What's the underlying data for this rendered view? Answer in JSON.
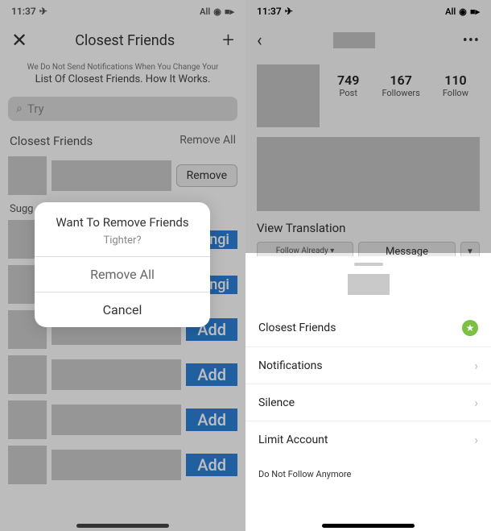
{
  "left": {
    "status": {
      "time": "11:37",
      "signal": "All"
    },
    "header": {
      "title": "Closest Friends"
    },
    "info": {
      "line1": "We Do Not Send Notifications When You Change Your",
      "line2": "List Of Closest Friends. How It Works."
    },
    "search": {
      "placeholder": "Try"
    },
    "section": {
      "label": "Closest Friends",
      "remove_all": "Remove All"
    },
    "remove_btn": "Remove",
    "suggested": "Sugg",
    "add_btn": "Add",
    "modal": {
      "title": "Want To Remove Friends",
      "subtitle": "Tighter?",
      "remove_all": "Remove All",
      "cancel": "Cancel"
    }
  },
  "right": {
    "status": {
      "time": "11:37",
      "signal": "All"
    },
    "stats": {
      "posts_num": "749",
      "posts_label": "Post",
      "followers_num": "167",
      "followers_label": "Followers",
      "following_num": "110",
      "following_label": "Follow"
    },
    "view_translation": "View Translation",
    "buttons": {
      "follow": "Follow Already ▾",
      "message": "Message"
    },
    "sheet": {
      "closest_friends": "Closest Friends",
      "notifications": "Notifications",
      "silence": "Silence",
      "limit_account": "Limit Account",
      "unfollow": "Do Not Follow Anymore"
    }
  }
}
